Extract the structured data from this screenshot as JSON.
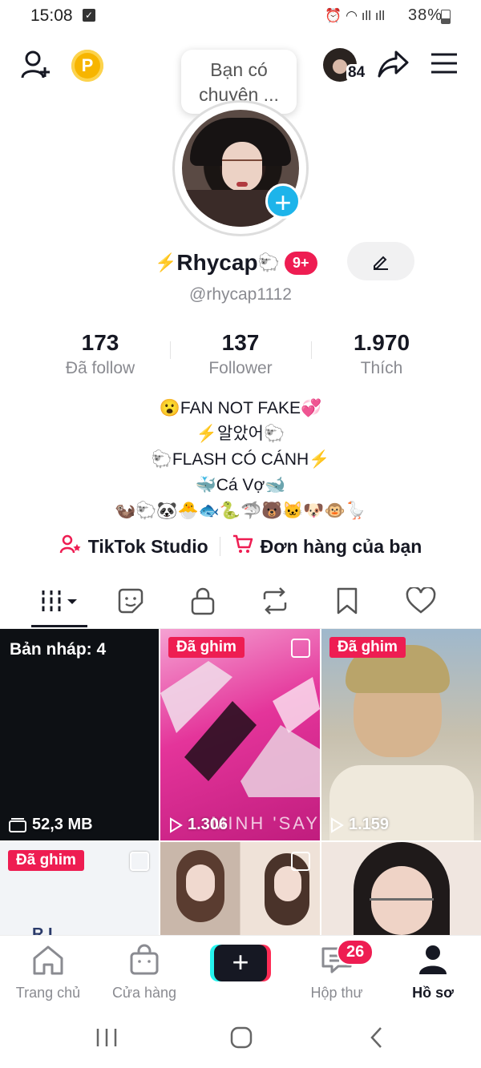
{
  "status_bar": {
    "time": "15:08",
    "battery": "38%"
  },
  "header": {
    "tooltip": "Bạn có chuyện ...",
    "mini_count": "84",
    "coin_label": "P"
  },
  "profile": {
    "name": "Rhycap",
    "name_emoji_before": "⚡",
    "name_emoji_after": "🐑",
    "notif_badge": "9+",
    "handle": "@rhycap1112",
    "stats": [
      {
        "num": "173",
        "label": "Đã follow"
      },
      {
        "num": "137",
        "label": "Follower"
      },
      {
        "num": "1.970",
        "label": "Thích"
      }
    ],
    "bio": [
      "😮FAN NOT FAKE💞",
      "⚡알았어🐑",
      "🐑FLASH CÓ CÁNH⚡",
      "🐳Cá Vợ🐋",
      "🦦🐑🐼🐣🐟🐍🦈🐻🐱🐶🐵🪿"
    ],
    "links": {
      "studio": "TikTok Studio",
      "orders": "Đơn hàng của bạn"
    }
  },
  "tabs": [
    "videos",
    "stickers",
    "private",
    "reposts",
    "favorites",
    "liked"
  ],
  "grid": [
    {
      "type": "draft",
      "label": "Bản nháp: 4",
      "size": "52,3 MB"
    },
    {
      "type": "video",
      "pinned": "Đã ghim",
      "views": "1.306",
      "overlay_text": "MINH 'SAY"
    },
    {
      "type": "video",
      "pinned": "Đã ghim",
      "views": "1.159"
    },
    {
      "type": "video",
      "pinned": "Đã ghim",
      "overlay_text": "R.I..."
    },
    {
      "type": "video"
    },
    {
      "type": "video"
    }
  ],
  "bottom_nav": {
    "home": "Trang chủ",
    "shop": "Cửa hàng",
    "inbox": "Hộp thư",
    "inbox_badge": "26",
    "profile": "Hồ sơ"
  },
  "colors": {
    "accent": "#ee1d52",
    "cyan": "#1db4ea",
    "text": "#161823",
    "muted": "#8a8b91"
  }
}
